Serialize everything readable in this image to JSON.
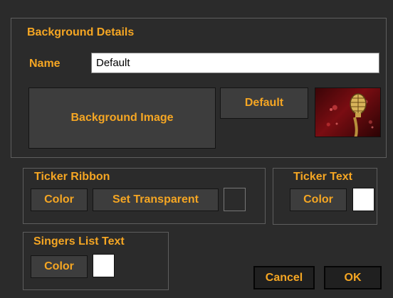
{
  "background_details": {
    "title": "Background Details",
    "name_label": "Name",
    "name_value": "Default",
    "background_image_button": "Background Image",
    "default_button": "Default",
    "thumbnail_icon": "microphone-icon"
  },
  "ticker_ribbon": {
    "title": "Ticker Ribbon",
    "color_button": "Color",
    "set_transparent_button": "Set Transparent",
    "swatch_color": "#2b2b2b"
  },
  "ticker_text": {
    "title": "Ticker Text",
    "color_button": "Color",
    "swatch_color": "#ffffff"
  },
  "singers_list_text": {
    "title": "Singers List Text",
    "color_button": "Color",
    "swatch_color": "#ffffff"
  },
  "footer": {
    "cancel_button": "Cancel",
    "ok_button": "OK"
  },
  "theme": {
    "background": "#2b2b2b",
    "accent": "#f5a623",
    "button_bg": "#3d3d3d"
  }
}
